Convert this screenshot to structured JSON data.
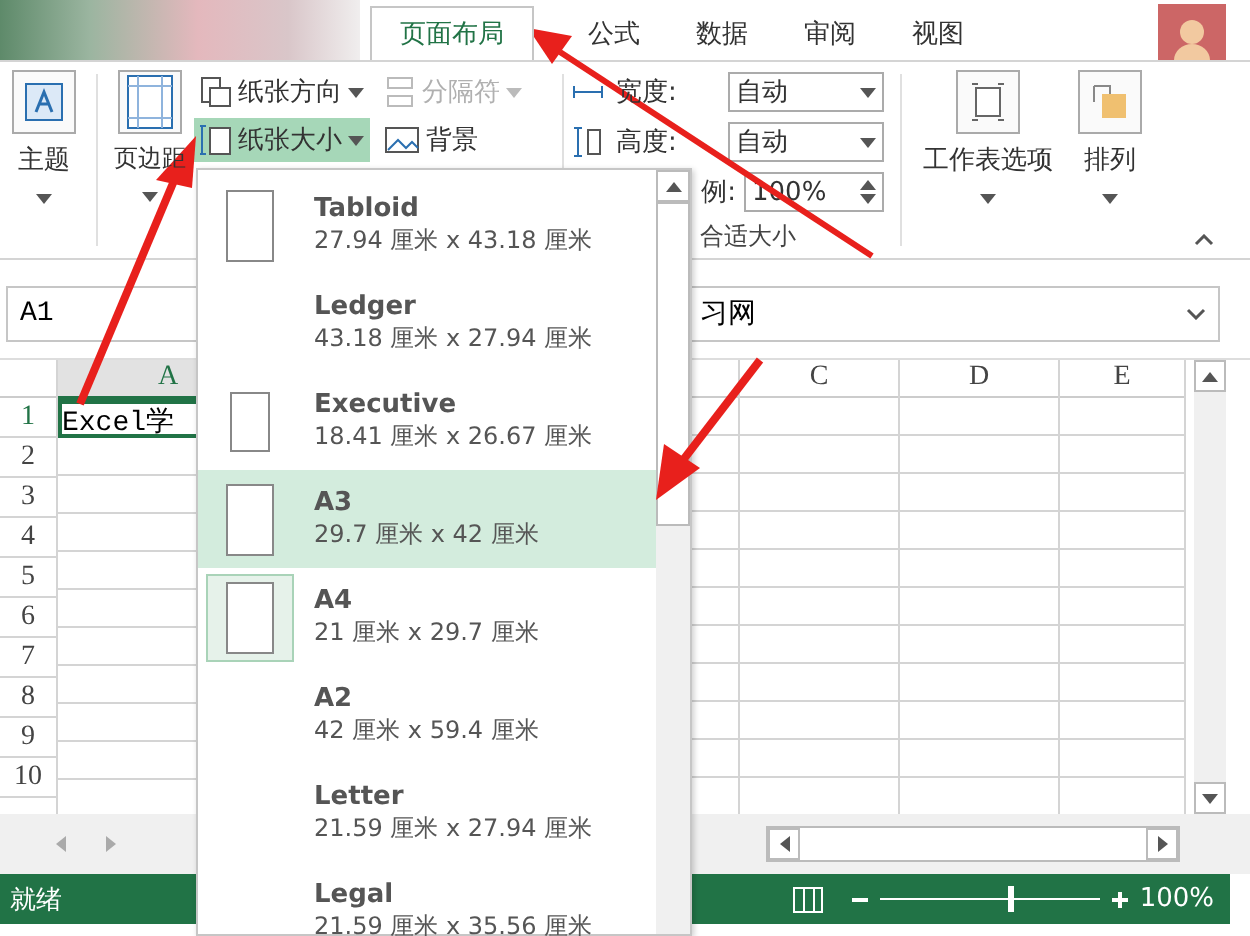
{
  "tabs": [
    {
      "label": "页面布局",
      "selected": true
    },
    {
      "label": "公式",
      "selected": false
    },
    {
      "label": "数据",
      "selected": false
    },
    {
      "label": "审阅",
      "selected": false
    },
    {
      "label": "视图",
      "selected": false
    }
  ],
  "ribbon": {
    "themes": "主题",
    "margins": "页边距",
    "small_buttons": [
      {
        "label": "纸张方向",
        "kind": "orientation",
        "dropdown": true,
        "disabled": false,
        "highlighted": false
      },
      {
        "label": "分隔符",
        "kind": "breaks",
        "dropdown": true,
        "disabled": true,
        "highlighted": false
      },
      {
        "label": "纸张大小",
        "kind": "size",
        "dropdown": true,
        "disabled": false,
        "highlighted": true
      },
      {
        "label": "背景",
        "kind": "background",
        "dropdown": false,
        "disabled": false,
        "highlighted": false
      }
    ],
    "scale_rows": [
      {
        "label": "宽度:",
        "value": "自动",
        "kind": "select"
      },
      {
        "label": "高度:",
        "value": "自动",
        "kind": "select"
      },
      {
        "label": "例:",
        "value": "100%",
        "kind": "spinner"
      }
    ],
    "scale_group": "合适大小",
    "sheet_options": "工作表选项",
    "arrange": "排列"
  },
  "formula_bar": {
    "name_box": "A1",
    "formula": "习网"
  },
  "sheet": {
    "left_columns": [
      "A"
    ],
    "right_columns": [
      "C",
      "D",
      "E"
    ],
    "rows": [
      "1",
      "2",
      "3",
      "4",
      "5",
      "6",
      "7",
      "8",
      "9",
      "10"
    ],
    "cell_a1": "Excel学"
  },
  "status_bar": {
    "status": "就绪",
    "zoom": "100%",
    "level": 0.58
  },
  "paper_menu": {
    "items": [
      {
        "name": "Tabloid",
        "size": "27.94 厘米 x 43.18 厘米",
        "has_icon": true,
        "selected": false,
        "current": false
      },
      {
        "name": "Ledger",
        "size": "43.18 厘米 x 27.94 厘米",
        "has_icon": false,
        "selected": false,
        "current": false
      },
      {
        "name": "Executive",
        "size": "18.41 厘米 x 26.67 厘米",
        "has_icon": true,
        "selected": false,
        "current": false
      },
      {
        "name": "A3",
        "size": "29.7 厘米 x 42 厘米",
        "has_icon": true,
        "selected": true,
        "current": false
      },
      {
        "name": "A4",
        "size": "21 厘米 x 29.7 厘米",
        "has_icon": true,
        "selected": false,
        "current": true
      },
      {
        "name": "A2",
        "size": "42 厘米 x 59.4 厘米",
        "has_icon": false,
        "selected": false,
        "current": false
      },
      {
        "name": "Letter",
        "size": "21.59 厘米 x 27.94 厘米",
        "has_icon": false,
        "selected": false,
        "current": false
      },
      {
        "name": "Legal",
        "size": "21.59 厘米 x 35.56 厘米",
        "has_icon": false,
        "selected": false,
        "current": false
      }
    ]
  }
}
